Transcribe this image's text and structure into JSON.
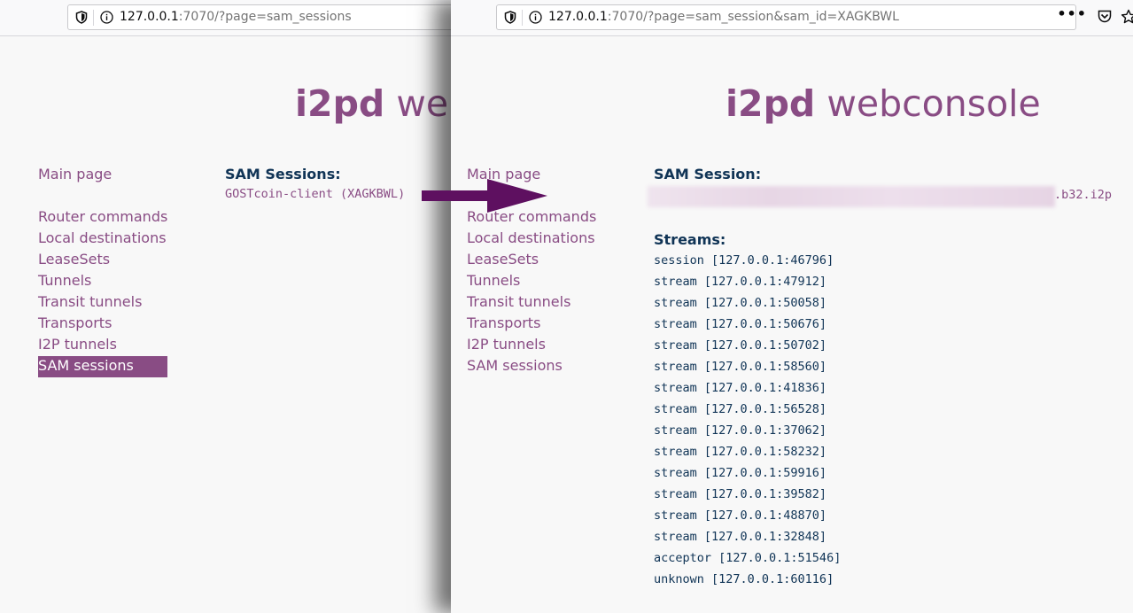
{
  "left": {
    "url": {
      "host": "127.0.0.1",
      "rest": ":7070/?page=sam_sessions"
    },
    "title": {
      "bold": "i2pd",
      "rest": " webconsole"
    },
    "menu": {
      "main": "Main page",
      "items": [
        "Router commands",
        "Local destinations",
        "LeaseSets",
        "Tunnels",
        "Transit tunnels",
        "Transports",
        "I2P tunnels",
        "SAM sessions"
      ],
      "active_index": 7
    },
    "content": {
      "heading": "SAM Sessions:",
      "session_link": "GOSTcoin-client (XAGKBWL)"
    }
  },
  "right": {
    "url": {
      "host": "127.0.0.1",
      "rest": ":7070/?page=sam_session&sam_id=XAGKBWL"
    },
    "toolbar": {
      "more_label": "•••"
    },
    "title": {
      "bold": "i2pd",
      "rest": " webconsole"
    },
    "menu": {
      "main": "Main page",
      "items": [
        "Router commands",
        "Local destinations",
        "LeaseSets",
        "Tunnels",
        "Transit tunnels",
        "Transports",
        "I2P tunnels",
        "SAM sessions"
      ]
    },
    "content": {
      "heading": "SAM Session:",
      "address_suffix": ".b32.i2p",
      "streams_heading": "Streams:",
      "streams": [
        "session [127.0.0.1:46796]",
        "stream [127.0.0.1:47912]",
        "stream [127.0.0.1:50058]",
        "stream [127.0.0.1:50676]",
        "stream [127.0.0.1:50702]",
        "stream [127.0.0.1:58560]",
        "stream [127.0.0.1:41836]",
        "stream [127.0.0.1:56528]",
        "stream [127.0.0.1:37062]",
        "stream [127.0.0.1:58232]",
        "stream [127.0.0.1:59916]",
        "stream [127.0.0.1:39582]",
        "stream [127.0.0.1:48870]",
        "stream [127.0.0.1:32848]",
        "acceptor [127.0.0.1:51546]",
        "unknown [127.0.0.1:60116]"
      ]
    }
  },
  "colors": {
    "accent": "#894c84",
    "heading": "#103456",
    "arrow": "#5e1060"
  },
  "icons": [
    "shield-icon",
    "info-icon",
    "more-icon",
    "pocket-icon",
    "bookmark-star-icon",
    "arrow-right-icon"
  ]
}
